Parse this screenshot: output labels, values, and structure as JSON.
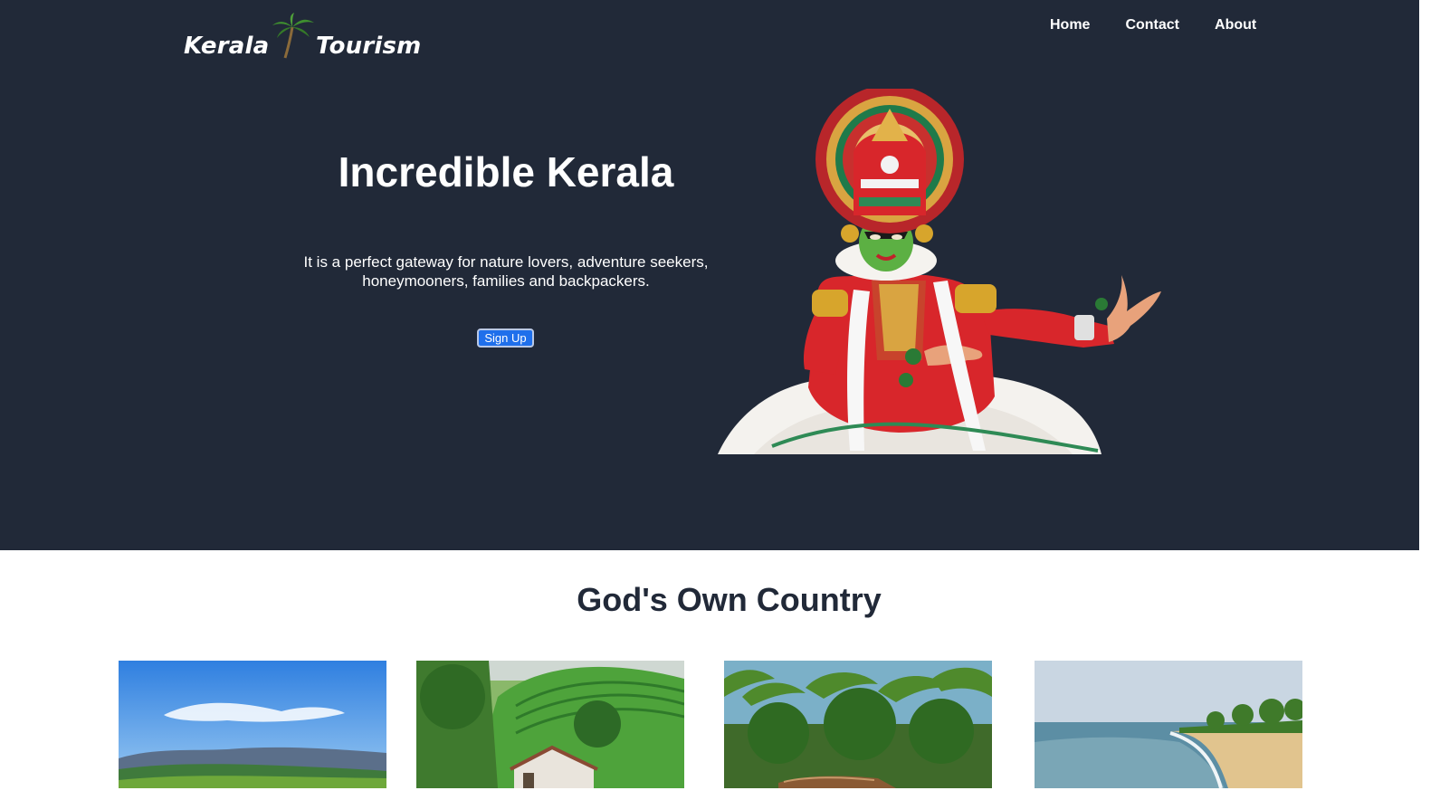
{
  "header": {
    "logo": {
      "word1": "Kerala",
      "word2": "Tourism",
      "icon": "palm-tree-icon"
    },
    "nav": [
      {
        "label": "Home"
      },
      {
        "label": "Contact"
      },
      {
        "label": "About"
      }
    ]
  },
  "hero": {
    "title": "Incredible Kerala",
    "line1": "It is a perfect gateway for nature lovers, adventure seekers,",
    "line2": "honeymooners, families and backpackers.",
    "cta_label": "Sign Up",
    "image": "kathakali-dancer-image"
  },
  "section": {
    "title": "God's Own Country",
    "cards": [
      {
        "image": "hills-landscape-image"
      },
      {
        "image": "tea-plantation-image"
      },
      {
        "image": "coconut-palms-image"
      },
      {
        "image": "beach-image"
      }
    ]
  },
  "colors": {
    "hero_bg": "#212938",
    "section_title": "#212938",
    "button_bg": "#1f6feb",
    "text_on_dark": "#ffffff"
  }
}
